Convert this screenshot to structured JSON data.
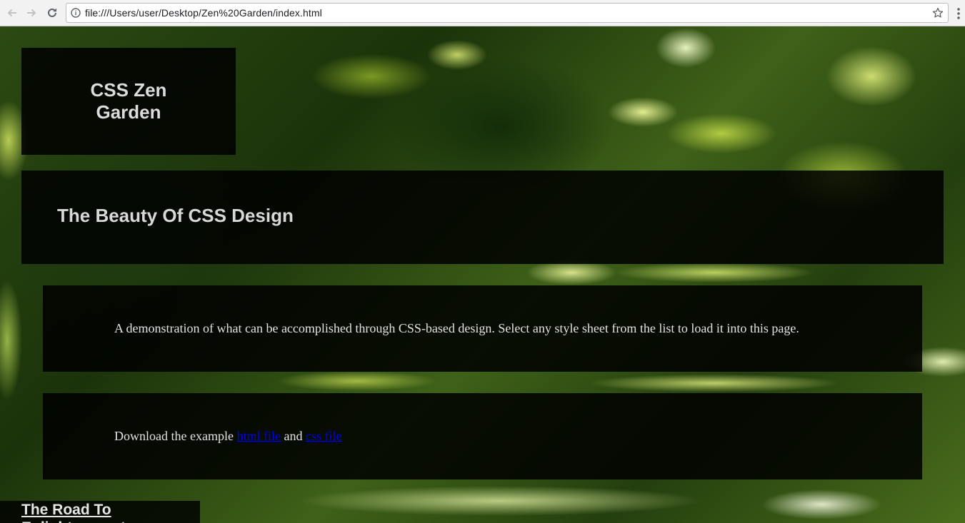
{
  "browser": {
    "url": "file:///Users/user/Desktop/Zen%20Garden/index.html",
    "icons": {
      "back": "back-arrow-icon",
      "forward": "forward-arrow-icon",
      "reload": "reload-icon",
      "info": "info-icon",
      "bookmark": "star-icon",
      "menu": "kebab-menu-icon"
    }
  },
  "page": {
    "site_title": "CSS Zen Garden",
    "tagline": "The Beauty Of CSS Design",
    "intro_text": "A demonstration of what can be accomplished through CSS-based design. Select any style sheet from the list to load it into this page.",
    "download": {
      "prefix": "Download the example ",
      "html_link": "html file",
      "middle": " and ",
      "css_link": "css file"
    },
    "road_heading": "The Road To Enlightenment"
  },
  "colors": {
    "panel": "#000000",
    "heading_text": "#dcdcdc",
    "link": "#0000ee"
  }
}
